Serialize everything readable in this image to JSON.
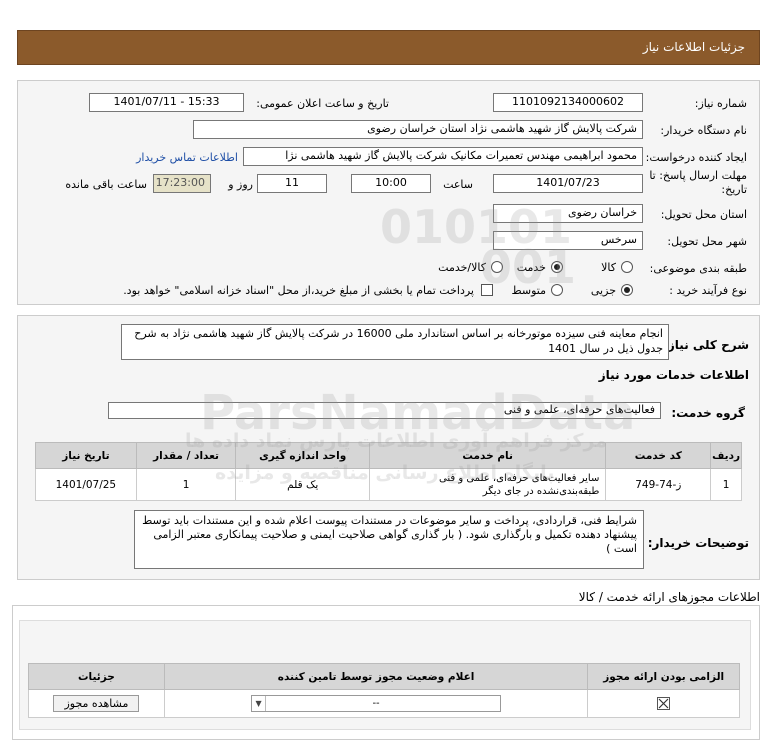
{
  "header": {
    "title": "جزئیات اطلاعات نیاز"
  },
  "form": {
    "need_number_label": "شماره نیاز:",
    "need_number": "1101092134000602",
    "announce_label": "تاریخ و ساعت اعلان عمومی:",
    "announce_value": "1401/07/11 - 15:33",
    "buyer_label": "نام دستگاه خریدار:",
    "buyer_value": "شرکت پالایش گاز شهید هاشمی نژاد   استان خراسان رضوی",
    "creator_label": "ایجاد کننده درخواست:",
    "creator_value": "محمود ابراهیمی مهندس تعمیرات مکانیک شرکت پالایش گاز شهید هاشمی نژا",
    "contact_link": "اطلاعات تماس خریدار",
    "deadline_label_1": "مهلت ارسال پاسخ: تا",
    "deadline_label_2": "تاریخ:",
    "deadline_date": "1401/07/23",
    "time_label": "ساعت",
    "deadline_time": "10:00",
    "days": "11",
    "days_label": "روز و",
    "remaining": "17:23:00",
    "remaining_label": "ساعت باقی مانده",
    "province_label": "استان محل تحویل:",
    "province": "خراسان رضوی",
    "city_label": "شهر محل تحویل:",
    "city": "سرخس",
    "category_label": "طبقه بندی موضوعی:",
    "category_options": [
      "کالا",
      "خدمت",
      "کالا/خدمت"
    ],
    "category_selected": "خدمت",
    "process_label": "نوع فرآیند خرید :",
    "process_options": [
      "جزیی",
      "متوسط"
    ],
    "process_selected": "جزیی",
    "payment_note": "پرداخت تمام یا بخشی از مبلغ خرید،از محل \"اسناد خزانه اسلامی\" خواهد بود."
  },
  "description": {
    "label": "شرح کلی نیاز:",
    "text": "انجام معاینه فنی سیزده  موتورخانه بر اساس استاندارد ملی 16000 در  شرکت پالایش گاز شهید هاشمی نژاد به شرح جدول ذیل در سال 1401"
  },
  "services": {
    "section_title": "اطلاعات خدمات مورد نیاز",
    "group_label": "گروه خدمت:",
    "group_value": "فعالیت‌های حرفه‌ای، علمی و فنی",
    "columns": [
      "ردیف",
      "کد خدمت",
      "نام خدمت",
      "واحد اندازه گیری",
      "تعداد / مقدار",
      "تاریخ نیاز"
    ],
    "rows": [
      {
        "row": "1",
        "code": "ز-74-749",
        "name": "سایر فعالیت‌های حرفه‌ای، علمی و فنی طبقه‌بندی‌نشده در جای دیگر",
        "unit": "یک قلم",
        "qty": "1",
        "date": "1401/07/25"
      }
    ]
  },
  "buyer_notes": {
    "label": "توضیحات خریدار:",
    "text": "شرایط فنی، قراردادی، پرداخت و سایر موضوعات در مستندات پیوست اعلام شده و این مستندات باید توسط پیشنهاد دهنده تکمیل و  بارگذاری شود. ( بار گذاری گواهی صلاحیت ایمنی و صلاحیت پیمانکاری معتبر الزامی است )"
  },
  "permits": {
    "section_title": "اطلاعات مجوزهای ارائه خدمت / کالا",
    "columns": [
      "الزامی بودن ارائه مجوز",
      "اعلام وضعیت مجوز توسط تامین کننده",
      "جزئیات"
    ],
    "select_value": "--",
    "view_button": "مشاهده مجوز"
  },
  "watermark": {
    "digits_1": "010101",
    "digits_2": "001",
    "brand": "ParsNamadData",
    "fa_1": "مرکز فراهم آوری اطلاعات پارس نماد داده ها",
    "fa_2": "پایگاه اطلاع رسانی مناقصه و مزایده"
  }
}
